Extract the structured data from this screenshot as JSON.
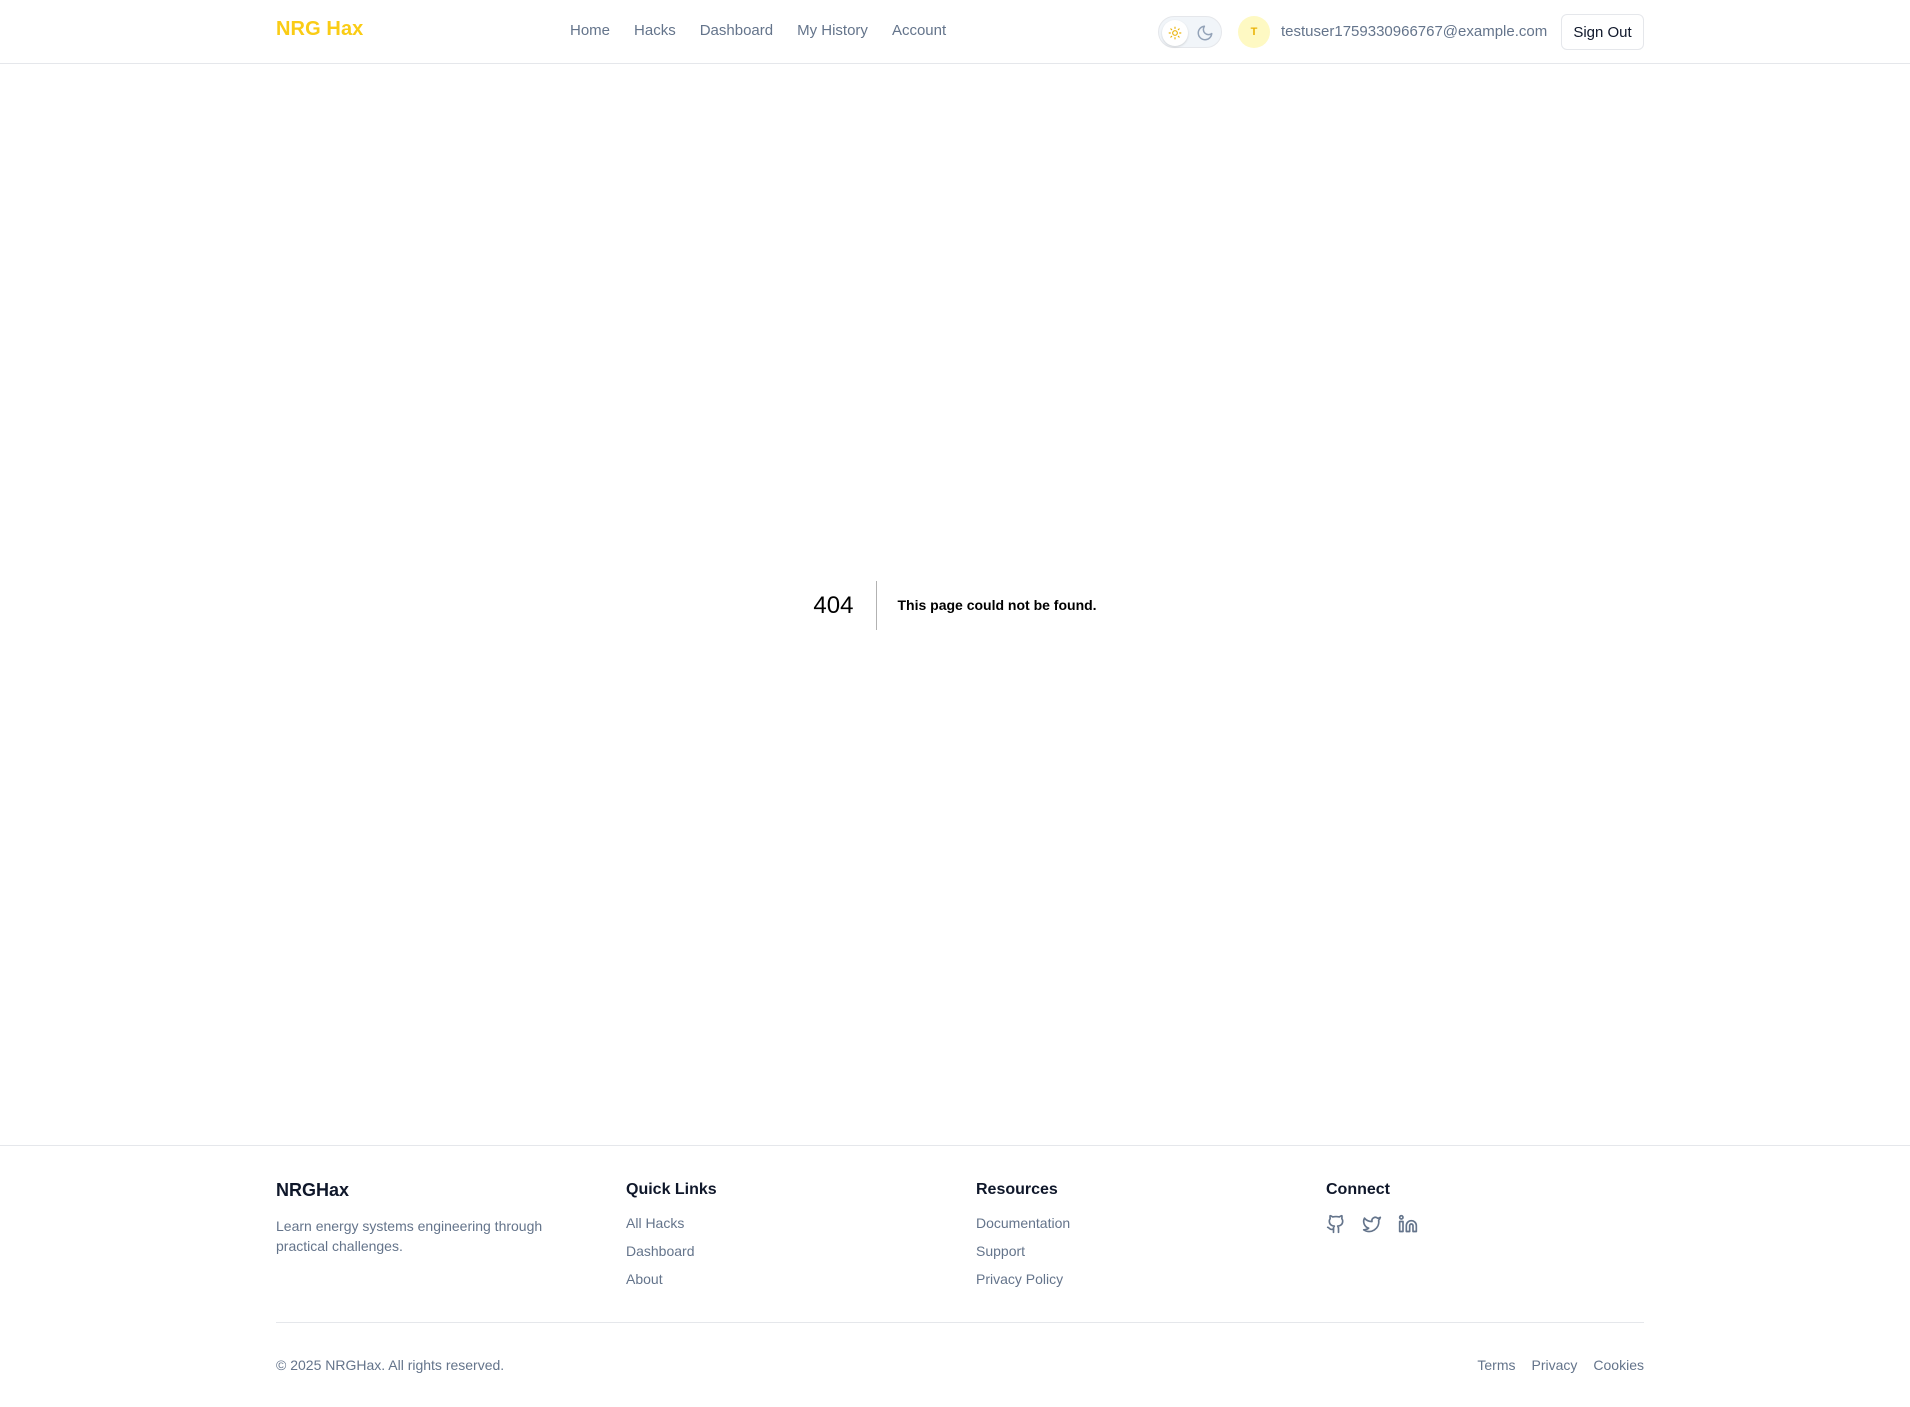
{
  "header": {
    "brand": "NRG Hax",
    "nav": [
      "Home",
      "Hacks",
      "Dashboard",
      "My History",
      "Account"
    ],
    "theme": {
      "mode": "light",
      "light_icon": "sun-icon",
      "dark_icon": "moon-icon"
    },
    "user": {
      "avatar_initial": "T",
      "email": "testuser1759330966767@example.com"
    },
    "signout_label": "Sign Out",
    "brand_color": "#facc15"
  },
  "error": {
    "code": "404",
    "message": "This page could not be found."
  },
  "footer": {
    "brand": "NRGHax",
    "description": "Learn energy systems engineering through practical challenges.",
    "quick_links": {
      "title": "Quick Links",
      "items": [
        "All Hacks",
        "Dashboard",
        "About"
      ]
    },
    "resources": {
      "title": "Resources",
      "items": [
        "Documentation",
        "Support",
        "Privacy Policy"
      ]
    },
    "connect": {
      "title": "Connect",
      "icons": [
        "github-icon",
        "twitter-icon",
        "linkedin-icon"
      ]
    },
    "copyright": "© 2025 NRGHax. All rights reserved.",
    "legal": [
      "Terms",
      "Privacy",
      "Cookies"
    ]
  }
}
